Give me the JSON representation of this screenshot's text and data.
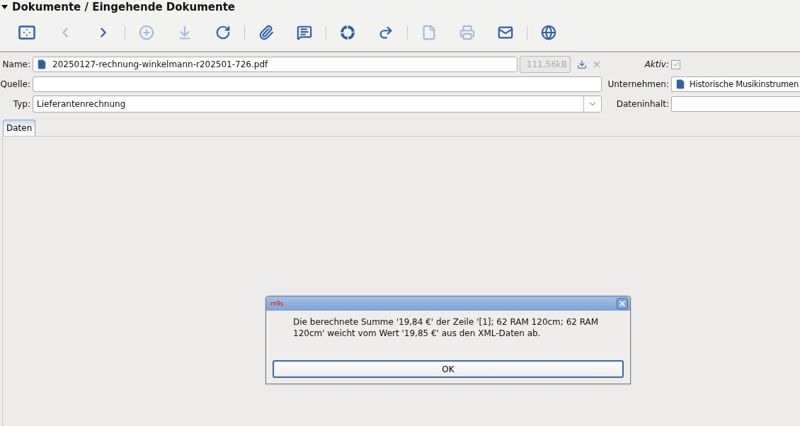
{
  "header": {
    "title": "Dokumente / Eingehende Dokumente",
    "expanded": true
  },
  "toolbar": [
    [
      {
        "kind": "fit",
        "disabled": false
      },
      {
        "kind": "back",
        "disabled": true
      },
      {
        "kind": "forward",
        "disabled": false
      }
    ],
    [
      {
        "kind": "add",
        "disabled": true
      },
      {
        "kind": "download",
        "disabled": true
      },
      {
        "kind": "refresh",
        "disabled": false
      }
    ],
    [
      {
        "kind": "attach",
        "disabled": false
      },
      {
        "kind": "comments",
        "disabled": false
      }
    ],
    [
      {
        "kind": "cycle",
        "disabled": false
      },
      {
        "kind": "redo",
        "disabled": false
      }
    ],
    [
      {
        "kind": "document",
        "disabled": true
      },
      {
        "kind": "print",
        "disabled": true
      },
      {
        "kind": "mail",
        "disabled": false
      }
    ],
    [
      {
        "kind": "globe",
        "disabled": false
      }
    ]
  ],
  "form": {
    "name": {
      "label": "Name:",
      "value": "20250127-rechnung-winkelmann-r202501-726.pdf",
      "size": "111,56kB"
    },
    "aktiv": {
      "label": "Aktiv:",
      "checked": true
    },
    "quelle": {
      "label": "Quelle:"
    },
    "unternehmen": {
      "label": "Unternehmen:",
      "value": "Historische Musikinstrumen"
    },
    "typ": {
      "label": "Typ:",
      "value": "Lieferantenrechnung"
    },
    "dateninhalt": {
      "label": "Dateninhalt:"
    }
  },
  "tabs": [
    {
      "label": "Daten",
      "selected": true
    }
  ],
  "dialog": {
    "logo": "m9s",
    "message": "Die berechnete Summe '19,84 €' der Zeile '[1]; 62 RAM 120cm; 62 RAM 120cm' weicht vom Wert '19,85 €' aus den XML-Daten ab.",
    "button": "OK"
  }
}
